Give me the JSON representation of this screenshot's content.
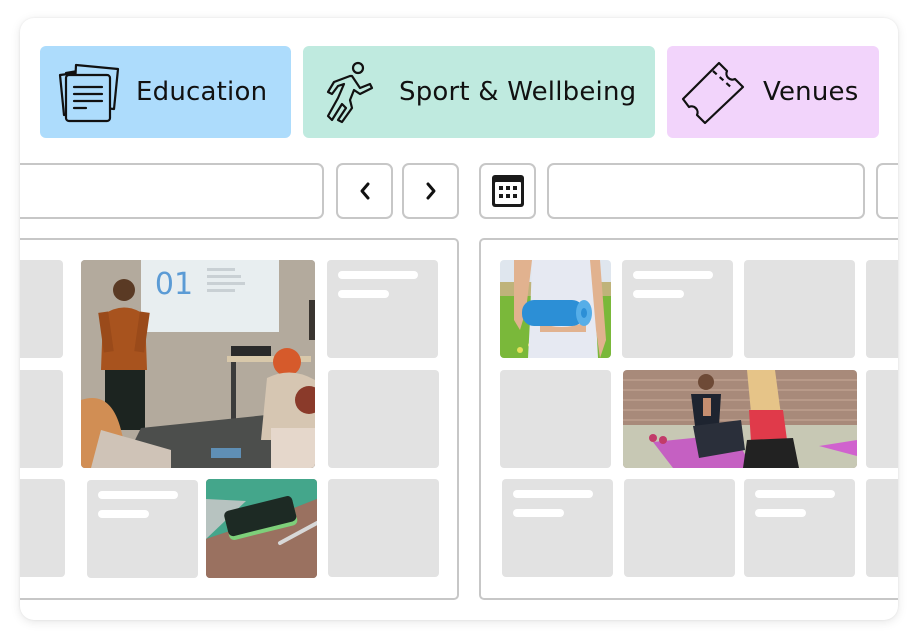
{
  "categories": [
    {
      "label": "Education",
      "icon": "documents-icon",
      "color": "#addcfc"
    },
    {
      "label": "Sport & Wellbeing",
      "icon": "running-person-icon",
      "color": "#bfeadf"
    },
    {
      "label": "Venues",
      "icon": "ticket-icon",
      "color": "#f2d4fb"
    }
  ],
  "toolbar": {
    "search_value": "",
    "prev_label": "‹",
    "next_label": "›",
    "date_value": "",
    "calendar_icon": "calendar-icon"
  },
  "panels": {
    "education": {
      "slide_number": "01",
      "photos": [
        "presentation-meeting-photo",
        "smartphone-on-desk-photo"
      ]
    },
    "sport": {
      "photos": [
        "yoga-mat-photo",
        "fitness-class-photo"
      ]
    }
  },
  "colors": {
    "placeholder_tile": "#e2e2e2",
    "border": "#c7c7c7",
    "slide_accent": "#5b9bd5"
  }
}
